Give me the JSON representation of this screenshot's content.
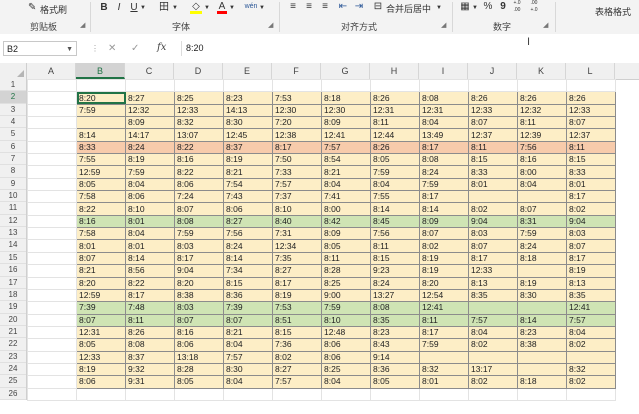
{
  "ribbon": {
    "format_painter": "格式刷",
    "clipboard_label": "剪贴板",
    "font_label": "字体",
    "alignment_label": "对齐方式",
    "number_label": "数字",
    "merge_center": "合并后居中",
    "table_format": "表格格式",
    "bold": "B",
    "italic": "I",
    "underline": "U",
    "border_glyph": "田",
    "fill_glyph": "◇",
    "font_color_glyph": "A",
    "wen": "wén",
    "percent": "%",
    "comma": "9",
    "dec_inc": "+.0 .00",
    "dec_dec": ".00 +.0"
  },
  "formula_bar": {
    "name_box": "B2",
    "cancel_glyph": "✕",
    "enter_glyph": "✓",
    "fx": "fx",
    "value": "8:20"
  },
  "columns": [
    "A",
    "B",
    "C",
    "D",
    "E",
    "F",
    "G",
    "H",
    "I",
    "J",
    "K",
    "L"
  ],
  "selected_column": "B",
  "row_numbers": [
    "1",
    "2",
    "3",
    "4",
    "5",
    "6",
    "7",
    "8",
    "9",
    "10",
    "11",
    "12",
    "13",
    "14",
    "15",
    "16",
    "17",
    "18",
    "19",
    "20",
    "21",
    "22",
    "23",
    "24",
    "25",
    "26"
  ],
  "selected_row": "2",
  "rows": [
    {
      "style": "empty",
      "cells": []
    },
    {
      "style": "plain",
      "cells": [
        "8:20",
        "8:27",
        "8:25",
        "8:23",
        "7:53",
        "8:18",
        "8:26",
        "8:08",
        "8:26",
        "8:26",
        "8:26",
        "8:26"
      ]
    },
    {
      "style": "plain",
      "cells": [
        "7:59",
        "12:32",
        "12:33",
        "14:13",
        "12:30",
        "12:30",
        "12:31",
        "12:31",
        "12:33",
        "12:32",
        "12:33",
        "12:3"
      ]
    },
    {
      "style": "plain",
      "cells": [
        "",
        "8:09",
        "8:32",
        "8:30",
        "7:20",
        "8:09",
        "8:11",
        "8:04",
        "8:07",
        "8:11",
        "8:07",
        "8:11"
      ]
    },
    {
      "style": "plain",
      "cells": [
        "8:14",
        "14:17",
        "13:07",
        "12:45",
        "12:38",
        "12:41",
        "12:44",
        "13:49",
        "12:37",
        "12:39",
        "12:37",
        "12:3"
      ]
    },
    {
      "style": "orange",
      "cells": [
        "8:33",
        "8:24",
        "8:22",
        "8:37",
        "8:17",
        "7:57",
        "8:26",
        "8:17",
        "8:11",
        "7:56",
        "8:11",
        "7:56"
      ]
    },
    {
      "style": "plain",
      "cells": [
        "7:55",
        "8:19",
        "8:16",
        "8:19",
        "7:50",
        "8:54",
        "8:05",
        "8:08",
        "8:15",
        "8:16",
        "8:15",
        "8:16"
      ]
    },
    {
      "style": "plain",
      "cells": [
        "12:59",
        "7:59",
        "8:22",
        "8:21",
        "7:33",
        "8:21",
        "7:59",
        "8:24",
        "8:33",
        "8:00",
        "8:33",
        "8:00"
      ]
    },
    {
      "style": "plain",
      "cells": [
        "8:05",
        "8:04",
        "8:06",
        "7:54",
        "7:57",
        "8:04",
        "8:04",
        "7:59",
        "8:01",
        "8:04",
        "8:01",
        "8:04"
      ]
    },
    {
      "style": "plain",
      "cells": [
        "7:58",
        "8:06",
        "7:24",
        "7:43",
        "7:37",
        "7:41",
        "7:55",
        "8:17",
        "",
        "",
        "8:17",
        ""
      ]
    },
    {
      "style": "plain",
      "cells": [
        "8:22",
        "8:10",
        "8:07",
        "8:06",
        "8:10",
        "8:00",
        "8:14",
        "8:14",
        "8:02",
        "8:07",
        "8:02",
        "8:07"
      ]
    },
    {
      "style": "green",
      "cells": [
        "8:16",
        "8:01",
        "8:08",
        "8:27",
        "8:40",
        "8:42",
        "8:45",
        "8:09",
        "9:04",
        "8:31",
        "9:04",
        "8:31"
      ]
    },
    {
      "style": "plain",
      "cells": [
        "7:58",
        "8:04",
        "7:59",
        "7:56",
        "7:31",
        "8:09",
        "7:56",
        "8:07",
        "8:03",
        "7:59",
        "8:03",
        "7:59"
      ]
    },
    {
      "style": "plain",
      "cells": [
        "8:01",
        "8:01",
        "8:03",
        "8:24",
        "12:34",
        "8:05",
        "8:11",
        "8:02",
        "8:07",
        "8:24",
        "8:07",
        "8:24"
      ]
    },
    {
      "style": "plain",
      "cells": [
        "8:07",
        "8:14",
        "8:17",
        "8:14",
        "7:35",
        "8:11",
        "8:15",
        "8:19",
        "8:17",
        "8:18",
        "8:17",
        "8:18"
      ]
    },
    {
      "style": "plain",
      "cells": [
        "8:21",
        "8:56",
        "9:04",
        "7:34",
        "8:27",
        "8:28",
        "9:23",
        "8:19",
        "12:33",
        "",
        "8:19",
        "12:3"
      ]
    },
    {
      "style": "plain",
      "cells": [
        "8:20",
        "8:22",
        "8:20",
        "8:15",
        "8:17",
        "8:25",
        "8:24",
        "8:20",
        "8:13",
        "8:19",
        "8:13",
        "8:19"
      ]
    },
    {
      "style": "plain",
      "cells": [
        "12:59",
        "8:17",
        "8:38",
        "8:36",
        "8:19",
        "9:00",
        "13:27",
        "12:54",
        "8:35",
        "8:30",
        "8:35",
        "8:30"
      ]
    },
    {
      "style": "green",
      "cells": [
        "7:39",
        "7:48",
        "8:03",
        "7:39",
        "7:53",
        "7:59",
        "8:08",
        "12:41",
        "",
        "",
        "12:41",
        ""
      ]
    },
    {
      "style": "green",
      "cells": [
        "8:07",
        "8:11",
        "8:07",
        "8:07",
        "8:51",
        "8:10",
        "8:35",
        "8:11",
        "7:57",
        "8:14",
        "7:57",
        "8:14"
      ]
    },
    {
      "style": "plain",
      "cells": [
        "12:31",
        "8:26",
        "8:16",
        "8:21",
        "8:15",
        "12:48",
        "8:23",
        "8:17",
        "8:04",
        "8:23",
        "8:04",
        "8:23"
      ]
    },
    {
      "style": "plain",
      "cells": [
        "8:05",
        "8:08",
        "8:06",
        "8:04",
        "7:36",
        "8:06",
        "8:43",
        "7:59",
        "8:02",
        "8:38",
        "8:02",
        "8:38"
      ]
    },
    {
      "style": "plain",
      "cells": [
        "12:33",
        "8:37",
        "13:18",
        "7:57",
        "8:02",
        "8:06",
        "9:14",
        "",
        "",
        "",
        "",
        ""
      ]
    },
    {
      "style": "plain",
      "cells": [
        "8:19",
        "9:32",
        "8:28",
        "8:30",
        "8:27",
        "8:25",
        "8:36",
        "8:32",
        "13:17",
        "",
        "8:32",
        "13:1"
      ]
    },
    {
      "style": "plain",
      "cells": [
        "8:06",
        "9:31",
        "8:05",
        "8:04",
        "7:57",
        "8:04",
        "8:05",
        "8:01",
        "8:02",
        "8:18",
        "8:02",
        "8:18"
      ]
    },
    {
      "style": "empty",
      "cells": []
    }
  ]
}
